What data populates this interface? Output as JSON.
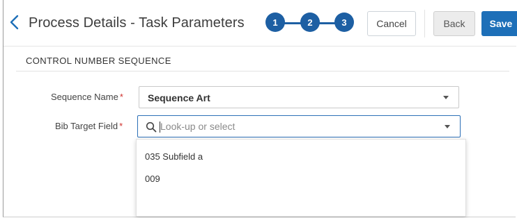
{
  "header": {
    "title": "Process Details - Task Parameters",
    "steps": [
      "1",
      "2",
      "3"
    ],
    "cancel_label": "Cancel",
    "back_label": "Back",
    "save_label": "Save"
  },
  "section": {
    "title": "CONTROL NUMBER SEQUENCE"
  },
  "form": {
    "sequence_name": {
      "label": "Sequence Name",
      "required_mark": "*",
      "value": "Sequence Art"
    },
    "bib_target_field": {
      "label": "Bib Target Field",
      "required_mark": "*",
      "placeholder": "Look-up or select",
      "options": [
        "035 Subfield a",
        "009"
      ]
    }
  },
  "colors": {
    "accent": "#1d5fa3",
    "save_button": "#1d6fb8",
    "required": "#d0312d"
  }
}
